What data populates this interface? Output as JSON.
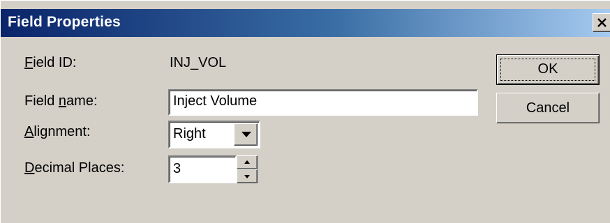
{
  "window": {
    "title": "Field Properties",
    "close_glyph": "close-icon"
  },
  "form": {
    "field_id": {
      "label_accel": "F",
      "label_rest": "ield ID:",
      "value": "INJ_VOL"
    },
    "field_name": {
      "label_pre": "Field ",
      "label_accel": "n",
      "label_rest": "ame:",
      "value": "Inject Volume"
    },
    "alignment": {
      "label_accel": "A",
      "label_rest": "lignment:",
      "selected": "Right",
      "dropdown_icon": "chevron-down-icon"
    },
    "decimal_places": {
      "label_accel": "D",
      "label_rest": "ecimal Places:",
      "value": "3",
      "spin_up_icon": "spin-up-icon",
      "spin_down_icon": "spin-down-icon"
    }
  },
  "buttons": {
    "ok_label": "OK",
    "cancel_label": "Cancel"
  },
  "colors": {
    "titlebar_start": "#0a246a",
    "titlebar_end": "#a6caf0",
    "dialog_face": "#d4d0c8"
  }
}
